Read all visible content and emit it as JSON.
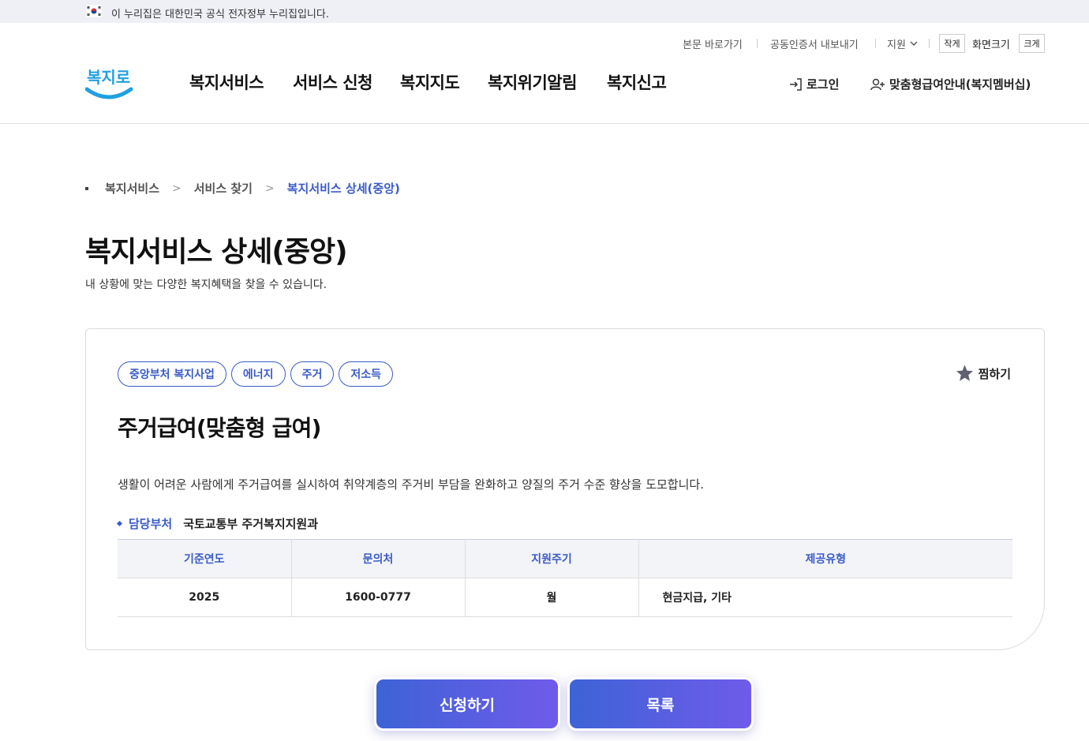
{
  "gov_banner": {
    "text": "이 누리집은 대한민국 공식 전자정부 누리집입니다."
  },
  "utility": {
    "skip_to_content": "본문 바로가기",
    "export_certificate": "공동인증서 내보내기",
    "support": "지원",
    "small_label": "작게",
    "screen_size_label": "화면크기",
    "large_label": "크게"
  },
  "logo": {
    "text": "복지로"
  },
  "nav": {
    "items": [
      "복지서비스",
      "서비스 신청",
      "복지지도",
      "복지위기알림",
      "복지신고"
    ],
    "login": "로그인",
    "membership": "맞춤형급여안내(복지멤버십)"
  },
  "breadcrumb": [
    "복지서비스",
    "서비스 찾기",
    "복지서비스 상세(중앙)"
  ],
  "page": {
    "title": "복지서비스 상세(중앙)",
    "description": "내 상황에 맞는 다양한 복지혜택을 찾을 수 있습니다."
  },
  "service": {
    "tags": [
      "중앙부처 복지사업",
      "에너지",
      "주거",
      "저소득"
    ],
    "favorite_label": "찜하기",
    "title": "주거급여(맞춤형 급여)",
    "description": "생활이 어려운 사람에게 주거급여를 실시하여 취약계층의 주거비 부담을 완화하고 양질의 주거 수준 향상을 도모합니다.",
    "department_label": "담당부처",
    "department_value": "국토교통부 주거복지지원과",
    "table": {
      "headers": [
        "기준연도",
        "문의처",
        "지원주기",
        "제공유형"
      ],
      "row": [
        "2025",
        "1600-0777",
        "월",
        "현금지급, 기타"
      ]
    }
  },
  "actions": {
    "apply": "신청하기",
    "list": "목록"
  },
  "colors": {
    "accent": "#3a5bc7",
    "gradient_start": "#3d63d6",
    "gradient_end": "#6f5bea",
    "logo_blue": "#1fa0e0"
  }
}
